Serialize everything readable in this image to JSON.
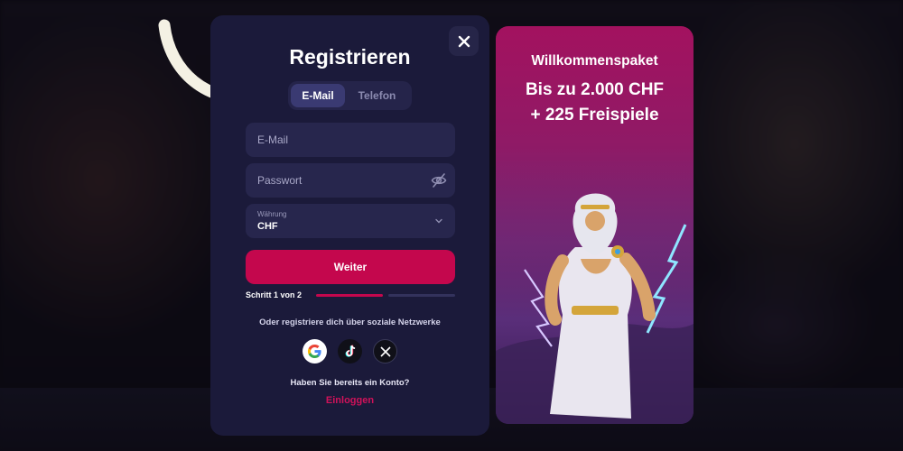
{
  "modal": {
    "title": "Registrieren",
    "close_icon": "close-icon",
    "tabs": [
      {
        "label": "E-Mail",
        "active": true
      },
      {
        "label": "Telefon",
        "active": false
      }
    ],
    "fields": {
      "email_placeholder": "E-Mail",
      "password_placeholder": "Passwort",
      "password_icon": "eye-off-icon",
      "currency_label": "Währung",
      "currency_value": "CHF",
      "currency_icon": "chevron-down-icon"
    },
    "next_button": "Weiter",
    "step": {
      "text": "Schritt 1 von 2",
      "current": 1,
      "total": 2
    },
    "social_text": "Oder registriere dich über soziale Netzwerke",
    "social": [
      "google-icon",
      "tiktok-icon",
      "x-icon"
    ],
    "have_account": "Haben Sie bereits ein Konto?",
    "login_link": "Einloggen"
  },
  "promo": {
    "subtitle": "Willkommenspaket",
    "line1": "Bis zu 2.000 CHF",
    "line2": "+ 225 Freispiele"
  },
  "colors": {
    "modal_bg": "#1b1a3a",
    "input_bg": "#27264d",
    "accent": "#c4074d",
    "promo_top": "#a3125f",
    "promo_bottom": "#3a1a55"
  }
}
